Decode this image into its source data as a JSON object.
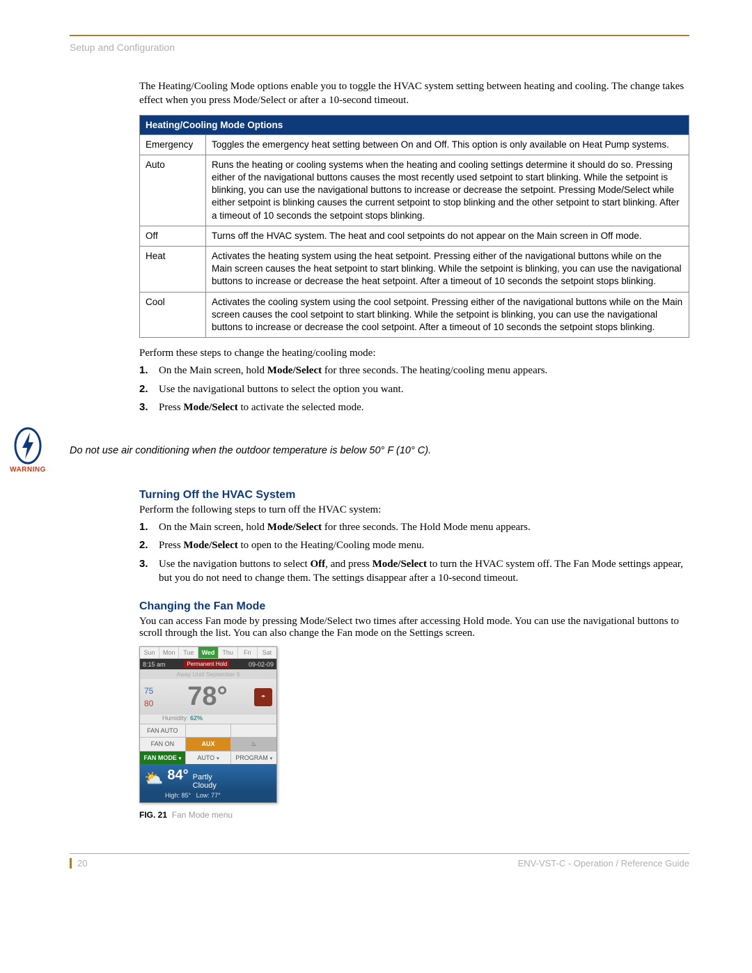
{
  "header": {
    "section": "Setup and Configuration"
  },
  "intro": "The Heating/Cooling Mode options enable you to toggle the HVAC system setting between heating and cooling. The change takes effect when you press Mode/Select or after a 10-second timeout.",
  "table": {
    "title": "Heating/Cooling Mode Options",
    "rows": [
      {
        "name": "Emergency",
        "desc": "Toggles the emergency heat setting between On and Off. This option is only available on Heat Pump systems."
      },
      {
        "name": "Auto",
        "desc": "Runs the heating or cooling systems when the heating and cooling settings determine it should do so. Pressing either of the navigational buttons causes the most recently used setpoint to start blinking. While the setpoint is blinking, you can use the navigational buttons to increase or decrease the setpoint. Pressing Mode/Select while either setpoint is blinking causes the current setpoint to stop blinking and the other setpoint to start blinking. After a timeout of 10 seconds the setpoint stops blinking."
      },
      {
        "name": "Off",
        "desc": "Turns off the HVAC system. The heat and cool setpoints do not appear on the Main screen in Off mode."
      },
      {
        "name": "Heat",
        "desc": "Activates the heating system using the heat setpoint. Pressing either of the navigational buttons while on the Main screen causes the heat setpoint to start blinking. While the setpoint is blinking, you can use the navigational buttons to increase or decrease the heat setpoint. After a timeout of 10 seconds the setpoint stops blinking."
      },
      {
        "name": "Cool",
        "desc": "Activates the cooling system using the cool setpoint. Pressing either of the navigational buttons while on the Main screen causes the cool setpoint to start blinking. While the setpoint is blinking, you can use the navigational buttons to increase or decrease the cool setpoint. After a timeout of 10 seconds the setpoint stops blinking."
      }
    ]
  },
  "steps_intro": "Perform these steps to change the heating/cooling mode:",
  "steps1": [
    {
      "pre": "On the Main screen, hold ",
      "bold": "Mode/Select",
      "post": " for three seconds. The heating/cooling menu appears."
    },
    {
      "pre": "Use the navigational buttons to select the option you want.",
      "bold": "",
      "post": ""
    },
    {
      "pre": "Press ",
      "bold": "Mode/Select",
      "post": " to activate the selected mode."
    }
  ],
  "warning": {
    "label": "WARNING",
    "text": "Do not use air conditioning when the outdoor temperature is below 50° F (10° C)."
  },
  "section_off": {
    "title": "Turning Off the HVAC System",
    "intro": "Perform the following steps to turn off the HVAC system:",
    "steps": [
      {
        "parts": [
          {
            "t": "On the Main screen, hold "
          },
          {
            "b": "Mode/Select"
          },
          {
            "t": " for three seconds. The Hold Mode menu appears."
          }
        ]
      },
      {
        "parts": [
          {
            "t": "Press "
          },
          {
            "b": "Mode/Select"
          },
          {
            "t": " to open to the Heating/Cooling mode menu."
          }
        ]
      },
      {
        "parts": [
          {
            "t": "Use the navigation buttons to select "
          },
          {
            "b": "Off"
          },
          {
            "t": ", and press "
          },
          {
            "b": "Mode/Select"
          },
          {
            "t": " to turn the HVAC system off. The Fan Mode settings appear, but you do not need to change them. The settings disappear after a 10-second timeout."
          }
        ]
      }
    ]
  },
  "section_fan": {
    "title": "Changing the Fan Mode",
    "intro": "You can access Fan mode by pressing Mode/Select two times after accessing Hold mode. You can use the navigational buttons to scroll through the list. You can also change the Fan mode on the Settings screen."
  },
  "thermostat": {
    "days": [
      "Sun",
      "Mon",
      "Tue",
      "Wed",
      "Thu",
      "Fri",
      "Sat"
    ],
    "selectedDay": "Wed",
    "time": "8:15 am",
    "hold": "Permanent Hold",
    "date": "09-02-09",
    "away": "Away Until September 6",
    "cool_sp": "75",
    "heat_sp": "80",
    "indoor": "78°",
    "humidity_label": "Humidity:",
    "humidity_val": "62%",
    "row1": [
      "FAN AUTO",
      "",
      ""
    ],
    "row2": {
      "left": "FAN ON",
      "mid": "AUX",
      "right_icon": "flame"
    },
    "row3": [
      "FAN MODE",
      "AUTO",
      "PROGRAM"
    ],
    "forecast": {
      "temp": "84°",
      "desc1": "Partly",
      "desc2": "Cloudy",
      "high": "High: 85°",
      "low": "Low: 77°"
    }
  },
  "figure": {
    "num": "FIG. 21",
    "caption": "Fan Mode menu"
  },
  "footer": {
    "page": "20",
    "doc": "ENV-VST-C - Operation / Reference Guide"
  }
}
